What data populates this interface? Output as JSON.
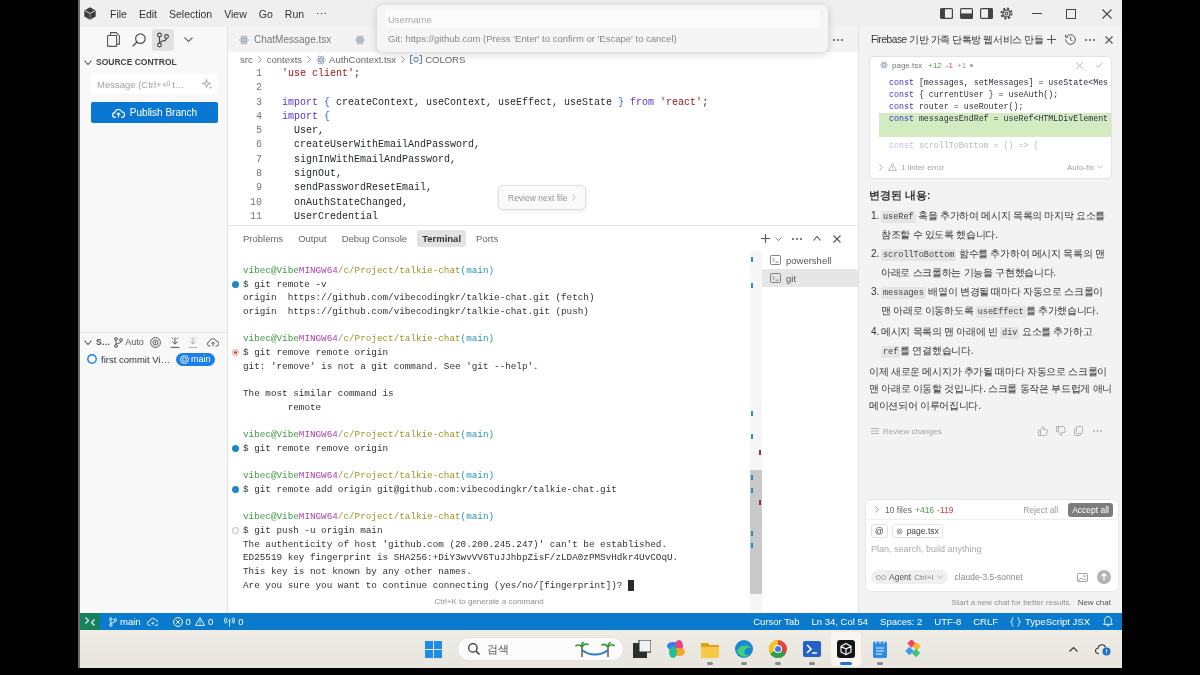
{
  "menu_bar": {
    "items": [
      "File",
      "Edit",
      "Selection",
      "View",
      "Go",
      "Run",
      "⋯"
    ]
  },
  "quick_input": {
    "placeholder": "Username",
    "description": "Git: https://github.com (Press 'Enter' to confirm or 'Escape' to cancel)"
  },
  "sidebar": {
    "title": "SOURCE CONTROL",
    "message_placeholder": "Message (Ctrl+⏎ t…",
    "publish_button": "Publish Branch",
    "graph": {
      "title": "S…",
      "auto_label": "Auto",
      "commits": [
        {
          "message": "first commit Vi…",
          "branch": "main"
        }
      ]
    }
  },
  "editor": {
    "tabs": [
      {
        "label": "ChatMessage.tsx",
        "selected": false
      }
    ],
    "breadcrumbs": [
      "src",
      "contexts",
      "AuthContext.tsx",
      "COLORS"
    ],
    "lines": [
      {
        "number": "1",
        "tokens": [
          {
            "text": "'use client'",
            "kind": "string"
          },
          {
            "text": ";",
            "kind": "plain"
          }
        ]
      },
      {
        "number": "2"
      },
      {
        "number": "3",
        "tokens": [
          {
            "text": "import",
            "kind": "keyword"
          },
          {
            "text": " {",
            "kind": "bracket"
          },
          {
            "text": " createContext, useContext, useEffect, useState ",
            "kind": "plain"
          },
          {
            "text": "}",
            "kind": "bracket"
          },
          {
            "text": " from",
            "kind": "keyword"
          },
          {
            "text": " 'react'",
            "kind": "string"
          },
          {
            "text": ";",
            "kind": "plain"
          }
        ]
      },
      {
        "number": "4",
        "tokens": [
          {
            "text": "import",
            "kind": "keyword"
          },
          {
            "text": " {",
            "kind": "bracket"
          }
        ]
      },
      {
        "number": "5",
        "tokens": [
          {
            "text": "  User,",
            "kind": "plain"
          }
        ]
      },
      {
        "number": "6",
        "tokens": [
          {
            "text": "  createUserWithEmailAndPassword,",
            "kind": "plain"
          }
        ]
      },
      {
        "number": "7",
        "tokens": [
          {
            "text": "  signInWithEmailAndPassword,",
            "kind": "plain"
          }
        ]
      },
      {
        "number": "8",
        "tokens": [
          {
            "text": "  signOut,",
            "kind": "plain"
          }
        ]
      },
      {
        "number": "9",
        "tokens": [
          {
            "text": "  sendPasswordResetEmail,",
            "kind": "plain"
          }
        ]
      },
      {
        "number": "10",
        "tokens": [
          {
            "text": "  onAuthStateChanged,",
            "kind": "plain"
          }
        ]
      },
      {
        "number": "11",
        "tokens": [
          {
            "text": "  UserCredential",
            "kind": "plain"
          }
        ]
      }
    ],
    "review_button": "Review next file"
  },
  "panel": {
    "tabs": [
      {
        "label": "Problems",
        "selected": false
      },
      {
        "label": "Output",
        "selected": false
      },
      {
        "label": "Debug Console",
        "selected": false
      },
      {
        "label": "Terminal",
        "selected": true
      },
      {
        "label": "Ports",
        "selected": false
      }
    ],
    "terminal": {
      "blocks": [
        {
          "prompt": {
            "user": "vibec@Vibe",
            "system": "MINGW64",
            "path": "/c/Project/talkie-chat",
            "branch": "(main)"
          },
          "command": "$ git remote -v",
          "kind": "success",
          "output": [
            [
              "origin  https://github.com/vibecodingkr/talkie-chat.git (fetch)",
              "origin  https://github.com/vibecodingkr/talkie-chat.git (push)"
            ]
          ]
        },
        {
          "prompt": {
            "user": "vibec@Vibe",
            "system": "MINGW64",
            "path": "/c/Project/talkie-chat",
            "branch": "(main)"
          },
          "command": "$ git remove remote origin",
          "kind": "error",
          "output": [
            [
              "git: 'remove' is not a git command. See 'git --help'."
            ],
            [
              "The most similar command is",
              "        remote"
            ]
          ]
        },
        {
          "prompt": {
            "user": "vibec@Vibe",
            "system": "MINGW64",
            "path": "/c/Project/talkie-chat",
            "branch": "(main)"
          },
          "command": "$ git remote remove origin",
          "kind": "success"
        },
        {
          "prompt": {
            "user": "vibec@Vibe",
            "system": "MINGW64",
            "path": "/c/Project/talkie-chat",
            "branch": "(main)"
          },
          "command": "$ git remote add origin git@github.com:vibecodingkr/talkie-chat.git",
          "kind": "success"
        },
        {
          "prompt": {
            "user": "vibec@Vibe",
            "system": "MINGW64",
            "path": "/c/Project/talkie-chat",
            "branch": "(main)"
          },
          "command": "$ git push -u origin main",
          "kind": "pending",
          "output": [
            [
              "The authenticity of host 'github.com (20.200.245.247)' can't be established.",
              "ED25519 key fingerprint is SHA256:+DiY3wvVV6TuJJhbpZisF/zLDA0zPMSvHdkr4UvCOqU.",
              "This key is not known by any other names.",
              "Are you sure you want to continue connecting (yes/no/[fingerprint])?"
            ]
          ]
        }
      ],
      "cursor_visible": true
    },
    "sessions": [
      {
        "name": "powershell",
        "selected": false
      },
      {
        "name": "git",
        "selected": true
      }
    ],
    "hint": "Ctrl+K to generate a command"
  },
  "chat": {
    "title": "Firebase 기반 가족 단톡방 웹서비스 만들",
    "diff": {
      "file": "page.tsx",
      "added": "+12",
      "removed": "-1",
      "changed": "+1",
      "lines": [
        {
          "kind": "context",
          "tokens": [
            {
              "text": "const",
              "kind": "keyword"
            },
            {
              "text": " [messages, setMessages] = useState<Mes",
              "kind": "plain"
            }
          ]
        },
        {
          "kind": "context",
          "tokens": [
            {
              "text": "const",
              "kind": "keyword"
            },
            {
              "text": " { currentUser } = useAuth();",
              "kind": "plain"
            }
          ]
        },
        {
          "kind": "context",
          "tokens": [
            {
              "text": "const",
              "kind": "keyword"
            },
            {
              "text": " router = useRouter();",
              "kind": "plain"
            }
          ]
        },
        {
          "kind": "added",
          "tokens": [
            {
              "text": "const",
              "kind": "keyword"
            },
            {
              "text": " messagesEndRef = useRef<HTMLDivElement",
              "kind": "plain"
            }
          ]
        },
        {
          "kind": "added"
        },
        {
          "kind": "faded",
          "tokens": [
            {
              "text": "const",
              "kind": "keyword"
            },
            {
              "text": " scrollToBottom = () => {",
              "kind": "plain"
            }
          ]
        }
      ],
      "linter": "1 linter error",
      "fix": "Auto-fix"
    },
    "heading": "변경된 내용:",
    "changes": [
      {
        "number": "1.",
        "parts": [
          {
            "text": "useRef",
            "kind": "code"
          },
          {
            "text": " 훅을 추가하여 메시지 목록의 마지막 요소를 참조할 수 있도록 했습니다.",
            "kind": "text"
          }
        ]
      },
      {
        "number": "2.",
        "parts": [
          {
            "text": "scrollToBottom",
            "kind": "code"
          },
          {
            "text": " 함수를 추가하여 메시지 목록의 맨 아래로 스크롤하는 기능을 구현했습니다.",
            "kind": "text"
          }
        ]
      },
      {
        "number": "3.",
        "parts": [
          {
            "text": "messages",
            "kind": "code"
          },
          {
            "text": " 배열이 변경될 때마다 자동으로 스크롤이 맨 아래로 이동하도록 ",
            "kind": "text"
          },
          {
            "text": "useEffect",
            "kind": "code"
          },
          {
            "text": "를 추가했습니다.",
            "kind": "text"
          }
        ]
      },
      {
        "number": "4.",
        "parts": [
          {
            "text": "메시지 목록의 맨 아래에 빈 ",
            "kind": "text"
          },
          {
            "text": "div",
            "kind": "code"
          },
          {
            "text": " 요소를 추가하고 ",
            "kind": "text"
          },
          {
            "text": "ref",
            "kind": "code"
          },
          {
            "text": "를 연결했습니다.",
            "kind": "text"
          }
        ]
      }
    ],
    "summary": "이제 새로운 메시지가 추가될 때마다 자동으로 스크롤이 맨 아래로 이동할 것입니다. 스크롤 동작은 부드럽게 애니메이션되어 이루어집니다.",
    "review": "Review changes",
    "files": {
      "count": "10 files",
      "added": "+416",
      "removed": "-119"
    },
    "reject": "Reject all",
    "accept": "Accept all",
    "composer": {
      "mention": "@",
      "file": "page.tsx",
      "placeholder": "Plan, search, build anything",
      "mode": "Agent",
      "shortcut": "Ctrl+I",
      "model": "claude-3.5-sonnet"
    },
    "hint": "Start a new chat for better results.",
    "new_chat": "New chat"
  },
  "status_bar": {
    "branch": "main",
    "errors": "0",
    "warnings": "0",
    "ports": "0",
    "items": [
      "Cursor Tab",
      "Ln 34, Col 54",
      "Spaces: 2",
      "UTF-8",
      "CRLF"
    ],
    "language": "TypeScript JSX"
  },
  "taskbar": {
    "search_placeholder": "검색",
    "apps": [
      {
        "kind": "stack",
        "running": false,
        "active": false
      },
      {
        "kind": "swirl",
        "running": false,
        "active": false
      },
      {
        "kind": "folder",
        "running": true,
        "active": false
      },
      {
        "kind": "wave",
        "running": true,
        "active": false
      },
      {
        "kind": "rings",
        "running": true,
        "active": false
      },
      {
        "kind": "shell",
        "running": true,
        "active": false
      },
      {
        "kind": "cube",
        "running": true,
        "active": true
      },
      {
        "kind": "notepad",
        "running": true,
        "active": false
      },
      {
        "kind": "tiles",
        "running": false,
        "active": false
      }
    ]
  }
}
